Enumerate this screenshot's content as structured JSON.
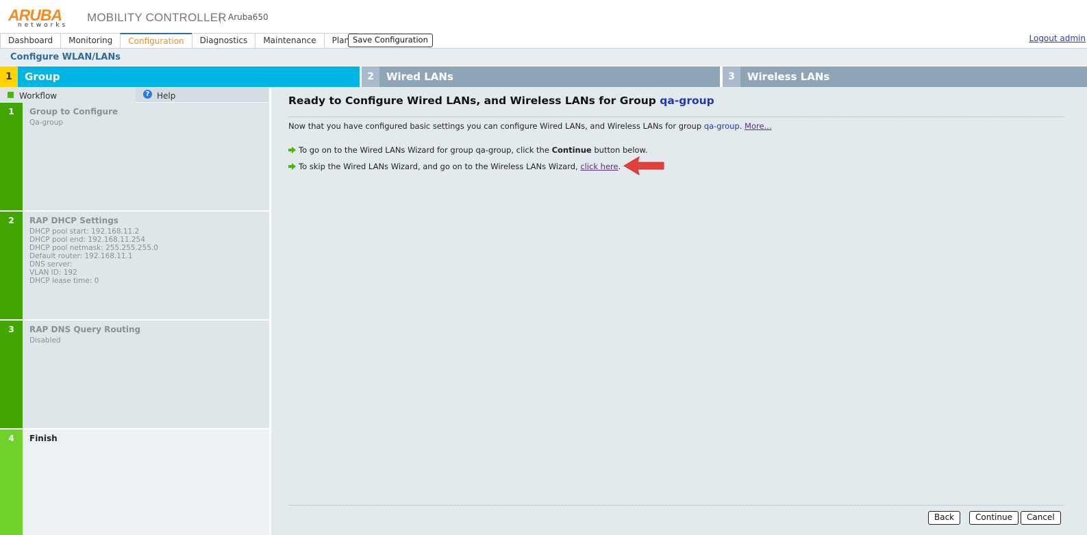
{
  "header": {
    "logo_text": "ARUBA",
    "logo_sub": "networks",
    "product": "MOBILITY CONTROLLER",
    "hostname": "Aruba650",
    "logout": "Logout admin"
  },
  "tabs": [
    {
      "label": "Dashboard"
    },
    {
      "label": "Monitoring"
    },
    {
      "label": "Configuration",
      "active": true
    },
    {
      "label": "Diagnostics"
    },
    {
      "label": "Maintenance"
    },
    {
      "label": "Plan"
    }
  ],
  "save_button": "Save Configuration",
  "page_title": "Configure WLAN/LANs",
  "steps": [
    {
      "num": "1",
      "label": "Group"
    },
    {
      "num": "2",
      "label": "Wired LANs"
    },
    {
      "num": "3",
      "label": "Wireless LANs"
    }
  ],
  "sidebar": {
    "workflow_tab": "Workflow",
    "help_tab": "Help",
    "help_icon": "?",
    "items": [
      {
        "num": "1",
        "title": "Group to Configure",
        "details": "Qa-group"
      },
      {
        "num": "2",
        "title": "RAP DHCP Settings",
        "details": "DHCP pool start: 192.168.11.2\nDHCP pool end: 192.168.11.254\nDHCP pool netmask: 255.255.255.0\nDefault router: 192.168.11.1\nDNS server:\nVLAN ID: 192\nDHCP lease time: 0"
      },
      {
        "num": "3",
        "title": "RAP DNS Query Routing",
        "details": "Disabled"
      },
      {
        "num": "4",
        "title": "Finish",
        "details": ""
      }
    ]
  },
  "main": {
    "heading_prefix": "Ready to Configure Wired LANs, and Wireless LANs for Group ",
    "heading_group": "qa-group",
    "intro_prefix": "Now that you have configured basic settings you can configure Wired LANs, and Wireless LANs for group ",
    "intro_group": "qa-group",
    "intro_dot": ".",
    "more_link": "More...",
    "bullet1_prefix": "To go on to the Wired LANs Wizard for group qa-group, click the ",
    "bullet1_bold": "Continue",
    "bullet1_suffix": " button below.",
    "bullet2_prefix": "To skip the Wired LANs Wizard, and go on to the Wireless LANs Wizard, ",
    "bullet2_link": "click here",
    "bullet2_suffix": "."
  },
  "buttons": {
    "back": "Back",
    "continue": "Continue",
    "cancel": "Cancel"
  },
  "colors": {
    "accent_orange": "#f68b1f",
    "step_active": "#00b5e4",
    "step_inactive": "#8ea5b8",
    "workflow_green": "#42a705",
    "annotation_red": "#e0413a"
  }
}
